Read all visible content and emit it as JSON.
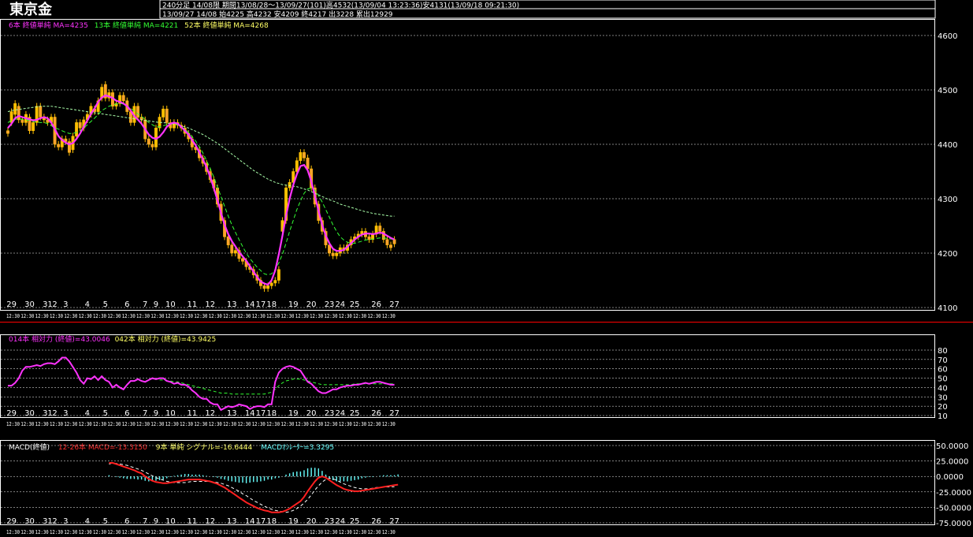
{
  "header": {
    "title": "東京金",
    "line1": "240分足 14/08限 期間13/08/28～13/09/27(101)高4532(13/09/04 13:23:36)安4131(13/09/18 09:21:30)",
    "line2": "13/09/27 14/08 始4225 高4232 安4209 終4217 出3228 累出12929"
  },
  "legend": {
    "ma6": "6本 終値単純 MA=4235",
    "ma13": "13本 終値単純 MA=4221",
    "ma52": "52本 終値単純 MA=4268",
    "rsi14": "014本 相対力 (終値)=43.0046",
    "rsi42": "042本 相対力 (終値)=43.9425",
    "macd_label": "MACD(終値)",
    "macd_line": "12-26本 MACD=-13.3150",
    "macd_signal": "9本 単純 シグナル=-16.6444",
    "macd_osc": "MACDｵｼﾚｰﾀｰ=3.3295"
  },
  "colors": {
    "candle_up": "#ffc000",
    "candle_down": "#ffa030",
    "ma6": "#ff33ff",
    "ma13": "#33ff33",
    "ma52": "#aaffaa",
    "rsi14": "#ff33ff",
    "rsi42": "#33ff33",
    "macd_line": "#ff2020",
    "macd_signal": "#ffffff",
    "macd_osc": "#66ffff",
    "grid": "#ffffff",
    "frame": "#ffffff",
    "separator": "#ff0000"
  },
  "x_axis": {
    "day_labels": [
      "29",
      "30",
      "31",
      "2",
      "3",
      "4",
      "5",
      "6",
      "7",
      "9",
      "10",
      "11",
      "12",
      "13",
      "14",
      "17",
      "18",
      "19",
      "20",
      "23",
      "24",
      "25",
      "26",
      "27"
    ],
    "day_label_index": [
      1,
      6,
      11,
      13,
      16,
      22,
      27,
      33,
      38,
      41,
      45,
      51,
      56,
      62,
      67,
      70,
      73,
      79,
      84,
      89,
      92,
      96,
      102,
      107
    ],
    "time_stub": "12:30"
  },
  "chart_data": [
    {
      "type": "candlestick",
      "title": "",
      "ylim": [
        4100,
        4620
      ],
      "yticks": [
        4100,
        4200,
        4300,
        4400,
        4500,
        4600
      ],
      "ohlc_close": [
        4420,
        4460,
        4475,
        4445,
        4440,
        4455,
        4425,
        4440,
        4470,
        4450,
        4445,
        4440,
        4450,
        4400,
        4395,
        4410,
        4405,
        4385,
        4415,
        4440,
        4430,
        4445,
        4455,
        4470,
        4460,
        4480,
        4505,
        4485,
        4495,
        4470,
        4475,
        4490,
        4480,
        4460,
        4440,
        4470,
        4450,
        4445,
        4410,
        4400,
        4395,
        4430,
        4450,
        4465,
        4440,
        4430,
        4440,
        4435,
        4430,
        4420,
        4410,
        4395,
        4390,
        4375,
        4365,
        4350,
        4335,
        4320,
        4290,
        4260,
        4230,
        4215,
        4200,
        4205,
        4190,
        4185,
        4175,
        4170,
        4160,
        4150,
        4140,
        4135,
        4140,
        4145,
        4150,
        4170,
        4260,
        4320,
        4330,
        4350,
        4370,
        4385,
        4375,
        4355,
        4320,
        4290,
        4260,
        4240,
        4215,
        4200,
        4195,
        4200,
        4210,
        4205,
        4215,
        4225,
        4230,
        4235,
        4240,
        4230,
        4225,
        4235,
        4250,
        4240,
        4225,
        4215,
        4210,
        4217
      ],
      "ohlc_open": [
        4425,
        4440,
        4455,
        4470,
        4445,
        4440,
        4450,
        4425,
        4440,
        4470,
        4450,
        4445,
        4440,
        4450,
        4400,
        4395,
        4410,
        4405,
        4390,
        4415,
        4440,
        4430,
        4445,
        4455,
        4465,
        4460,
        4485,
        4510,
        4485,
        4495,
        4470,
        4475,
        4490,
        4480,
        4460,
        4440,
        4470,
        4450,
        4445,
        4410,
        4400,
        4395,
        4430,
        4450,
        4465,
        4440,
        4430,
        4440,
        4435,
        4430,
        4420,
        4410,
        4395,
        4390,
        4375,
        4365,
        4350,
        4335,
        4320,
        4290,
        4260,
        4230,
        4215,
        4200,
        4205,
        4190,
        4185,
        4175,
        4170,
        4160,
        4150,
        4140,
        4135,
        4140,
        4145,
        4150,
        4240,
        4260,
        4320,
        4330,
        4350,
        4370,
        4385,
        4375,
        4355,
        4320,
        4290,
        4260,
        4240,
        4215,
        4200,
        4195,
        4200,
        4210,
        4205,
        4215,
        4225,
        4230,
        4235,
        4240,
        4230,
        4225,
        4235,
        4250,
        4240,
        4225,
        4215,
        4225
      ],
      "ma6": [
        4430,
        4438,
        4448,
        4452,
        4450,
        4448,
        4446,
        4444,
        4445,
        4448,
        4450,
        4448,
        4440,
        4428,
        4415,
        4408,
        4403,
        4400,
        4402,
        4410,
        4420,
        4432,
        4444,
        4456,
        4466,
        4478,
        4486,
        4490,
        4488,
        4485,
        4480,
        4478,
        4475,
        4470,
        4462,
        4452,
        4445,
        4438,
        4428,
        4418,
        4412,
        4410,
        4414,
        4422,
        4432,
        4438,
        4440,
        4438,
        4432,
        4425,
        4418,
        4408,
        4398,
        4385,
        4372,
        4358,
        4340,
        4320,
        4298,
        4274,
        4252,
        4235,
        4222,
        4212,
        4202,
        4194,
        4186,
        4176,
        4166,
        4156,
        4148,
        4144,
        4142,
        4150,
        4168,
        4198,
        4232,
        4268,
        4300,
        4325,
        4345,
        4360,
        4362,
        4352,
        4332,
        4305,
        4278,
        4252,
        4232,
        4218,
        4208,
        4204,
        4204,
        4206,
        4212,
        4218,
        4225,
        4230,
        4234,
        4236,
        4236,
        4235,
        4236,
        4238,
        4236,
        4232,
        4228,
        4225
      ],
      "ma13": [
        4440,
        4444,
        4446,
        4447,
        4446,
        4445,
        4444,
        4442,
        4441,
        4440,
        4440,
        4438,
        4434,
        4430,
        4428,
        4425,
        4422,
        4420,
        4420,
        4422,
        4425,
        4430,
        4436,
        4442,
        4448,
        4455,
        4462,
        4466,
        4470,
        4472,
        4474,
        4475,
        4474,
        4470,
        4466,
        4461,
        4456,
        4451,
        4446,
        4440,
        4436,
        4432,
        4432,
        4434,
        4436,
        4438,
        4438,
        4436,
        4432,
        4428,
        4422,
        4414,
        4406,
        4396,
        4384,
        4370,
        4356,
        4340,
        4322,
        4304,
        4286,
        4268,
        4252,
        4238,
        4225,
        4212,
        4200,
        4190,
        4182,
        4174,
        4168,
        4162,
        4160,
        4162,
        4170,
        4182,
        4198,
        4218,
        4240,
        4260,
        4280,
        4296,
        4310,
        4318,
        4320,
        4316,
        4306,
        4294,
        4280,
        4266,
        4252,
        4240,
        4230,
        4224,
        4220,
        4218,
        4218,
        4220,
        4222,
        4224,
        4225,
        4226,
        4227,
        4228,
        4228,
        4227,
        4226,
        4225
      ],
      "ma52": [
        4460,
        4462,
        4463,
        4464,
        4465,
        4466,
        4467,
        4468,
        4469,
        4470,
        4470,
        4470,
        4470,
        4469,
        4468,
        4467,
        4466,
        4465,
        4464,
        4463,
        4462,
        4461,
        4460,
        4459,
        4458,
        4457,
        4456,
        4455,
        4454,
        4453,
        4452,
        4451,
        4450,
        4449,
        4448,
        4447,
        4446,
        4445,
        4444,
        4443,
        4442,
        4441,
        4440,
        4440,
        4439,
        4438,
        4437,
        4436,
        4434,
        4432,
        4430,
        4427,
        4424,
        4421,
        4418,
        4414,
        4410,
        4406,
        4402,
        4397,
        4392,
        4387,
        4382,
        4377,
        4372,
        4367,
        4362,
        4357,
        4352,
        4348,
        4344,
        4340,
        4336,
        4333,
        4330,
        4328,
        4326,
        4325,
        4324,
        4323,
        4322,
        4320,
        4318,
        4316,
        4313,
        4310,
        4307,
        4304,
        4301,
        4298,
        4296,
        4293,
        4290,
        4288,
        4286,
        4284,
        4282,
        4280,
        4278,
        4276,
        4275,
        4273,
        4272,
        4271,
        4270,
        4269,
        4268,
        4268
      ]
    },
    {
      "type": "line",
      "title": "",
      "ylim": [
        10,
        80
      ],
      "yticks": [
        10,
        20,
        30,
        40,
        50,
        60,
        70,
        80
      ],
      "rsi14": [
        42,
        42,
        45,
        50,
        58,
        62,
        62,
        63,
        64,
        63,
        65,
        66,
        66,
        65,
        68,
        72,
        72,
        68,
        62,
        56,
        48,
        44,
        50,
        49,
        52,
        48,
        52,
        48,
        46,
        40,
        43,
        40,
        38,
        43,
        47,
        47,
        49,
        47,
        46,
        48,
        50,
        49,
        50,
        50,
        47,
        46,
        44,
        45,
        43,
        43,
        41,
        37,
        34,
        30,
        28,
        28,
        24,
        22,
        22,
        16,
        18,
        20,
        19,
        20,
        22,
        21,
        20,
        17,
        19,
        20,
        20,
        19,
        22,
        22,
        46,
        56,
        60,
        62,
        63,
        62,
        60,
        58,
        52,
        46,
        44,
        40,
        36,
        34,
        34,
        36,
        38,
        38,
        40,
        41,
        42,
        42,
        43,
        43,
        44,
        45,
        44,
        45,
        46,
        46,
        45,
        44,
        43,
        43
      ],
      "rsi42": [
        null,
        null,
        null,
        null,
        null,
        null,
        null,
        null,
        null,
        null,
        null,
        null,
        null,
        null,
        null,
        null,
        null,
        null,
        null,
        null,
        null,
        null,
        null,
        null,
        null,
        null,
        null,
        null,
        null,
        null,
        null,
        null,
        null,
        null,
        null,
        null,
        null,
        null,
        null,
        null,
        null,
        null,
        48,
        48,
        47,
        47,
        46,
        46,
        45,
        44,
        43,
        42,
        41,
        40,
        39,
        38,
        37,
        36,
        35,
        34,
        34,
        34,
        33,
        33,
        33,
        33,
        33,
        33,
        33,
        33,
        33,
        33,
        34,
        35,
        38,
        42,
        45,
        47,
        48,
        49,
        49,
        49,
        48,
        47,
        46,
        45,
        44,
        43,
        43,
        43,
        43,
        43,
        43,
        43,
        43,
        43,
        44,
        44,
        44,
        44,
        44,
        44,
        44,
        44,
        44,
        44,
        44,
        44
      ]
    },
    {
      "type": "line+bar",
      "title": "",
      "ylim": [
        -75,
        50
      ],
      "yticks": [
        -75,
        -50,
        -25,
        0,
        25,
        50
      ],
      "macd": [
        null,
        null,
        null,
        null,
        null,
        null,
        null,
        null,
        null,
        null,
        null,
        null,
        null,
        null,
        null,
        null,
        null,
        null,
        null,
        null,
        null,
        null,
        null,
        null,
        null,
        null,
        null,
        null,
        22,
        22,
        20,
        18,
        16,
        14,
        12,
        10,
        7,
        5,
        0,
        -4,
        -7,
        -9,
        -10,
        -11,
        -11,
        -10,
        -9,
        -8,
        -7,
        -6,
        -5,
        -5,
        -5,
        -5,
        -6,
        -7,
        -8,
        -10,
        -12,
        -15,
        -18,
        -22,
        -26,
        -30,
        -34,
        -38,
        -42,
        -45,
        -48,
        -51,
        -53,
        -55,
        -56,
        -58,
        -58,
        -58,
        -57,
        -55,
        -52,
        -48,
        -44,
        -40,
        -33,
        -24,
        -16,
        -8,
        -2,
        0,
        -2,
        -6,
        -10,
        -14,
        -17,
        -20,
        -22,
        -23,
        -24,
        -24,
        -23,
        -22,
        -21,
        -20,
        -19,
        -18,
        -17,
        -16,
        -15,
        -14,
        -13.3
      ],
      "signal": [
        null,
        null,
        null,
        null,
        null,
        null,
        null,
        null,
        null,
        null,
        null,
        null,
        null,
        null,
        null,
        null,
        null,
        null,
        null,
        null,
        null,
        null,
        null,
        null,
        null,
        null,
        null,
        null,
        20,
        22,
        21,
        20,
        19,
        18,
        16,
        14,
        12,
        10,
        7,
        4,
        1,
        -2,
        -4,
        -6,
        -8,
        -9,
        -10,
        -10,
        -10,
        -10,
        -9,
        -8,
        -8,
        -8,
        -8,
        -8,
        -8,
        -9,
        -10,
        -11,
        -13,
        -15,
        -18,
        -21,
        -24,
        -28,
        -31,
        -35,
        -39,
        -42,
        -45,
        -48,
        -51,
        -53,
        -55,
        -56,
        -57,
        -58,
        -57,
        -55,
        -52,
        -48,
        -43,
        -37,
        -30,
        -22,
        -15,
        -9,
        -5,
        -3,
        -4,
        -6,
        -9,
        -12,
        -14,
        -16,
        -18,
        -19,
        -20,
        -20,
        -20,
        -19,
        -18,
        -18,
        -17,
        -17,
        -17,
        -16.6
      ],
      "oscillator": [
        null,
        null,
        null,
        null,
        null,
        null,
        null,
        null,
        null,
        null,
        null,
        null,
        null,
        null,
        null,
        null,
        null,
        null,
        null,
        null,
        null,
        null,
        null,
        null,
        null,
        null,
        null,
        null,
        2,
        0,
        -1,
        -2,
        -3,
        -4,
        -4,
        -4,
        -5,
        -5,
        -7,
        -8,
        -8,
        -7,
        -6,
        -5,
        -3,
        -1,
        1,
        2,
        3,
        4,
        4,
        3,
        3,
        3,
        2,
        1,
        0,
        -1,
        -2,
        -4,
        -5,
        -7,
        -8,
        -9,
        -10,
        -10,
        -11,
        -10,
        -9,
        -9,
        -8,
        -7,
        -5,
        -5,
        -3,
        -2,
        0,
        3,
        5,
        7,
        8,
        8,
        10,
        13,
        14,
        14,
        13,
        9,
        3,
        -3,
        -6,
        -8,
        -8,
        -8,
        -8,
        -7,
        -6,
        -5,
        -3,
        -2,
        -1,
        -1,
        0,
        1,
        2,
        2,
        2,
        2,
        3.3
      ]
    }
  ]
}
